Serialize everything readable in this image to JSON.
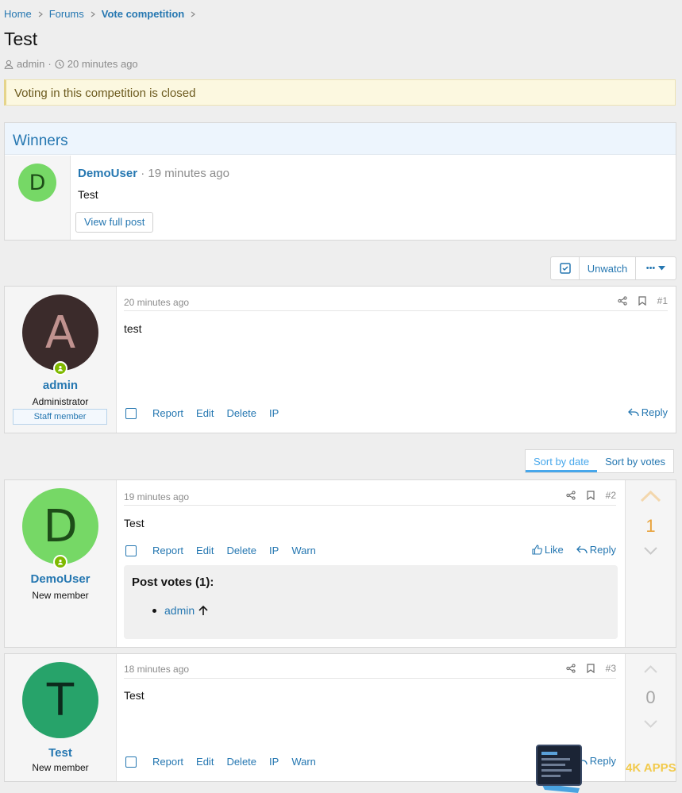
{
  "breadcrumb": {
    "items": [
      "Home",
      "Forums",
      "Vote competition"
    ]
  },
  "thread": {
    "title": "Test",
    "author": "admin",
    "time": "20 minutes ago"
  },
  "notice": "Voting in this competition is closed",
  "winners": {
    "heading": "Winners",
    "avatar_letter": "D",
    "user": "DemoUser",
    "time": "· 19 minutes ago",
    "body": "Test",
    "button": "View full post",
    "avatar_color": "#76d866"
  },
  "toolbar": {
    "unwatch": "Unwatch",
    "more": "•••"
  },
  "sort": {
    "by_date": "Sort by date",
    "by_votes": "Sort by votes"
  },
  "posts": [
    {
      "avatar_letter": "A",
      "avatar_bg": "#3b2b2b",
      "avatar_fg": "#c0928f",
      "user": "admin",
      "user_title": "Administrator",
      "banner": "Staff member",
      "time": "20 minutes ago",
      "number": "#1",
      "body": "test",
      "actions": [
        "Report",
        "Edit",
        "Delete",
        "IP"
      ],
      "reply": "Reply"
    },
    {
      "avatar_letter": "D",
      "avatar_bg": "#76d866",
      "avatar_fg": "#1d4d18",
      "user": "DemoUser",
      "user_title": "New member",
      "time": "19 minutes ago",
      "number": "#2",
      "body": "Test",
      "actions": [
        "Report",
        "Edit",
        "Delete",
        "IP",
        "Warn"
      ],
      "like": "Like",
      "reply": "Reply",
      "score": "1",
      "votes_title": "Post votes (1):",
      "voter": "admin"
    },
    {
      "avatar_letter": "T",
      "avatar_bg": "#27a36a",
      "avatar_fg": "#0c2a1c",
      "user": "Test",
      "user_title": "New member",
      "time": "18 minutes ago",
      "number": "#3",
      "body": "Test",
      "actions": [
        "Report",
        "Edit",
        "Delete",
        "IP",
        "Warn"
      ],
      "reply": "Reply",
      "score": "0"
    }
  ],
  "watermark": "4K APPS",
  "colors": {
    "link": "#2577b1",
    "online": "#7fb900",
    "score_accent": "#e8a33d"
  }
}
